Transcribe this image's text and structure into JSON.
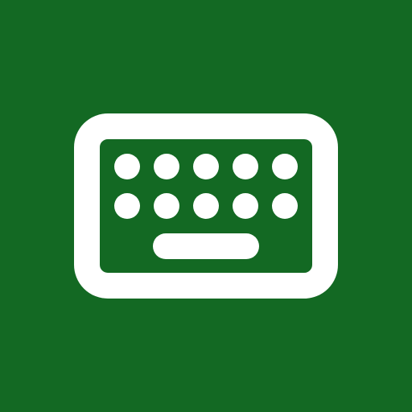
{
  "icon": {
    "name": "keyboard-icon",
    "background_color": "#136923",
    "glyph_color": "#ffffff",
    "key_rows": 2,
    "keys_per_row": 5,
    "has_spacebar": true
  }
}
